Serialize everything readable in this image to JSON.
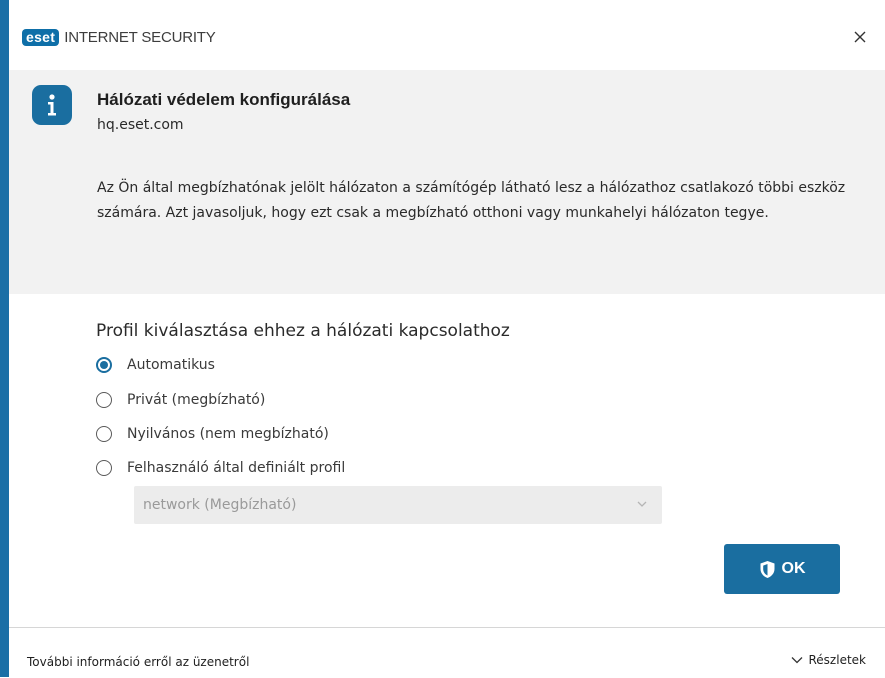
{
  "window": {
    "logo": "eset",
    "product": "INTERNET SECURITY",
    "close_icon": "close-icon"
  },
  "header": {
    "icon": "info-icon",
    "title": "Hálózati védelem konfigurálása",
    "subtitle": "hq.eset.com",
    "description": "Az Ön által megbízhatónak jelölt hálózaton a számítógép látható lesz a hálózathoz csatlakozó többi eszköz számára. Azt javasoljuk, hogy ezt csak a megbízható otthoni vagy munkahelyi hálózaton tegye."
  },
  "profile": {
    "title": "Profil kiválasztása ehhez a hálózati kapcsolathoz",
    "options": [
      {
        "label": "Automatikus",
        "checked": true
      },
      {
        "label": "Privát (megbízható)",
        "checked": false
      },
      {
        "label": "Nyilvános (nem megbízható)",
        "checked": false
      },
      {
        "label": "Felhasználó által definiált profil",
        "checked": false
      }
    ],
    "select_value": "network (Megbízható)"
  },
  "actions": {
    "ok_label": "OK",
    "ok_icon": "shield-icon"
  },
  "footer": {
    "more_info": "További információ erről az üzenetről",
    "details": "Részletek"
  },
  "colors": {
    "accent": "#1a6ea0",
    "header_bg": "#f2f2f2",
    "left_bar": "#1b6fa6"
  }
}
